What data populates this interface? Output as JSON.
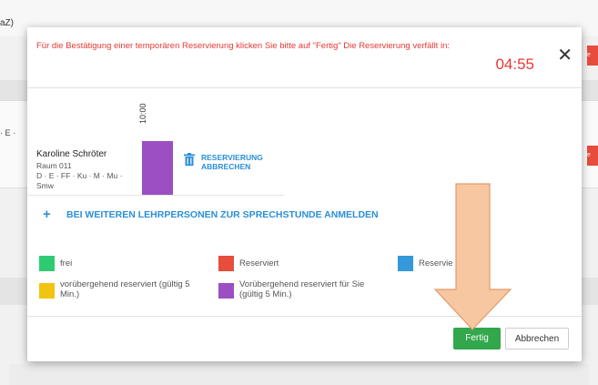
{
  "background": {
    "title_fragment": "aZ)",
    "side_text": "· E ·",
    "red_button_fragment": "e"
  },
  "dialog": {
    "header_message": "Für die Bestätigung einer temporären Reservierung klicken Sie bitte auf \"Fertig\" Die Reservierung verfällt in:",
    "countdown": "04:55",
    "close_symbol": "✕"
  },
  "teacher": {
    "name": "Karoline Schröter",
    "room": "Raum 011",
    "subjects": "D · E · FF · Ku · M · Mu · Smw"
  },
  "slot": {
    "time": "10:00"
  },
  "cancel_reservation_label": "RESERVIERUNG ABBRECHEN",
  "more_teachers": {
    "plus": "+",
    "label": "BEI WEITEREN LEHRPERSONEN ZUR SPRECHSTUNDE ANMELDEN"
  },
  "legend": [
    {
      "color": "#2ecc71",
      "label": "frei"
    },
    {
      "color": "#e74c3c",
      "label": "Reserviert"
    },
    {
      "color": "#3498db",
      "label": "Reservie         e"
    },
    {
      "color": "#f1c40f",
      "label": "vorübergehend reserviert (gültig 5 Min.)"
    },
    {
      "color": "#9b4fc2",
      "label": "Vorübergehend reserviert für Sie (gültig 5 Min.)"
    }
  ],
  "footer": {
    "done_label": "Fertig",
    "cancel_label": "Abbrechen"
  },
  "colors": {
    "accent_blue": "#2a8fd8",
    "alert_red": "#e53935",
    "done_green": "#32a74b",
    "arrow_fill": "#f7c7a1",
    "arrow_stroke": "#e39a6a"
  }
}
